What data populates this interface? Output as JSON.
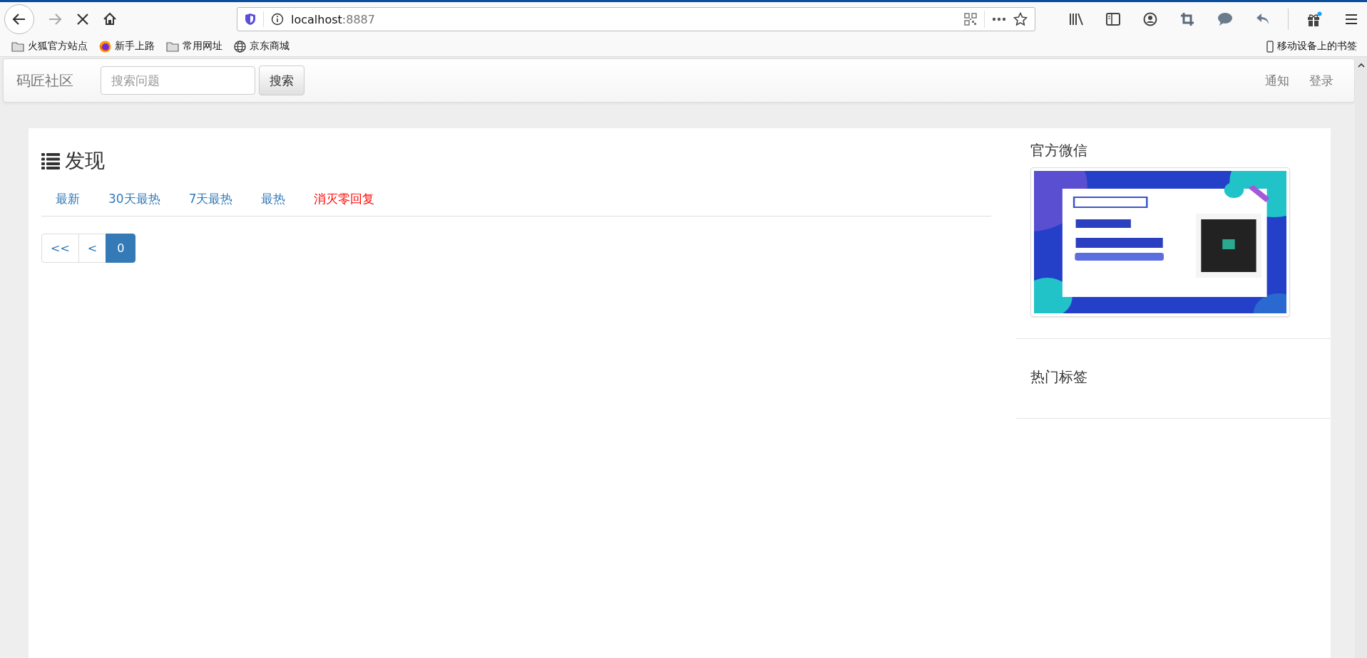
{
  "browser": {
    "url": {
      "host": "localhost",
      "port": ":8887"
    },
    "bookmarks": [
      {
        "label": "火狐官方站点",
        "kind": "folder"
      },
      {
        "label": "新手上路",
        "kind": "firefox"
      },
      {
        "label": "常用网址",
        "kind": "folder"
      },
      {
        "label": "京东商城",
        "kind": "globe"
      }
    ],
    "mobile_bookmarks": "移动设备上的书签"
  },
  "navbar": {
    "brand": "码匠社区",
    "search": {
      "placeholder": "搜索问题"
    },
    "search_button": "搜索",
    "links": [
      "通知",
      "登录"
    ]
  },
  "main": {
    "title": "发现",
    "tabs": [
      {
        "label": "最新",
        "kind": "normal"
      },
      {
        "label": "30天最热",
        "kind": "normal"
      },
      {
        "label": "7天最热",
        "kind": "normal"
      },
      {
        "label": "最热",
        "kind": "normal"
      },
      {
        "label": "消灭零回复",
        "kind": "alert"
      }
    ],
    "pagination": [
      {
        "label": "<<",
        "selected": false
      },
      {
        "label": "<",
        "selected": false
      },
      {
        "label": "0",
        "selected": true
      }
    ]
  },
  "sidebar": [
    {
      "title": "官方微信"
    },
    {
      "title": "热门标签"
    }
  ]
}
